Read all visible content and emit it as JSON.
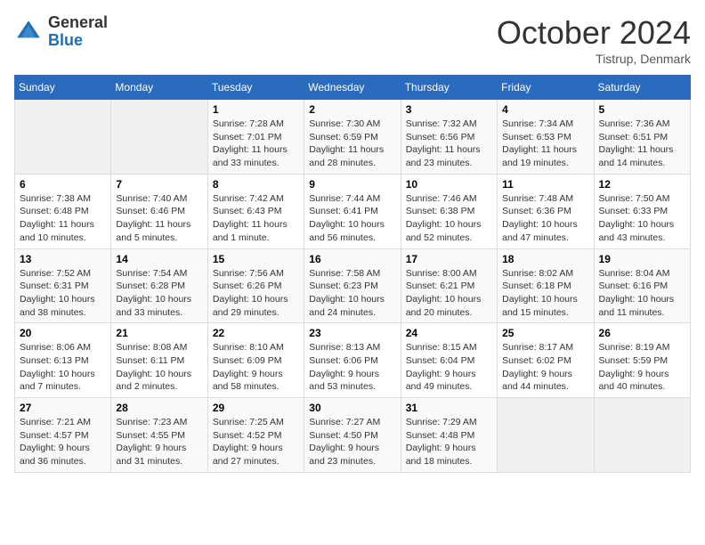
{
  "header": {
    "logo_general": "General",
    "logo_blue": "Blue",
    "month_title": "October 2024",
    "location": "Tistrup, Denmark"
  },
  "weekdays": [
    "Sunday",
    "Monday",
    "Tuesday",
    "Wednesday",
    "Thursday",
    "Friday",
    "Saturday"
  ],
  "weeks": [
    [
      {
        "day": "",
        "sunrise": "",
        "sunset": "",
        "daylight": ""
      },
      {
        "day": "",
        "sunrise": "",
        "sunset": "",
        "daylight": ""
      },
      {
        "day": "1",
        "sunrise": "Sunrise: 7:28 AM",
        "sunset": "Sunset: 7:01 PM",
        "daylight": "Daylight: 11 hours and 33 minutes."
      },
      {
        "day": "2",
        "sunrise": "Sunrise: 7:30 AM",
        "sunset": "Sunset: 6:59 PM",
        "daylight": "Daylight: 11 hours and 28 minutes."
      },
      {
        "day": "3",
        "sunrise": "Sunrise: 7:32 AM",
        "sunset": "Sunset: 6:56 PM",
        "daylight": "Daylight: 11 hours and 23 minutes."
      },
      {
        "day": "4",
        "sunrise": "Sunrise: 7:34 AM",
        "sunset": "Sunset: 6:53 PM",
        "daylight": "Daylight: 11 hours and 19 minutes."
      },
      {
        "day": "5",
        "sunrise": "Sunrise: 7:36 AM",
        "sunset": "Sunset: 6:51 PM",
        "daylight": "Daylight: 11 hours and 14 minutes."
      }
    ],
    [
      {
        "day": "6",
        "sunrise": "Sunrise: 7:38 AM",
        "sunset": "Sunset: 6:48 PM",
        "daylight": "Daylight: 11 hours and 10 minutes."
      },
      {
        "day": "7",
        "sunrise": "Sunrise: 7:40 AM",
        "sunset": "Sunset: 6:46 PM",
        "daylight": "Daylight: 11 hours and 5 minutes."
      },
      {
        "day": "8",
        "sunrise": "Sunrise: 7:42 AM",
        "sunset": "Sunset: 6:43 PM",
        "daylight": "Daylight: 11 hours and 1 minute."
      },
      {
        "day": "9",
        "sunrise": "Sunrise: 7:44 AM",
        "sunset": "Sunset: 6:41 PM",
        "daylight": "Daylight: 10 hours and 56 minutes."
      },
      {
        "day": "10",
        "sunrise": "Sunrise: 7:46 AM",
        "sunset": "Sunset: 6:38 PM",
        "daylight": "Daylight: 10 hours and 52 minutes."
      },
      {
        "day": "11",
        "sunrise": "Sunrise: 7:48 AM",
        "sunset": "Sunset: 6:36 PM",
        "daylight": "Daylight: 10 hours and 47 minutes."
      },
      {
        "day": "12",
        "sunrise": "Sunrise: 7:50 AM",
        "sunset": "Sunset: 6:33 PM",
        "daylight": "Daylight: 10 hours and 43 minutes."
      }
    ],
    [
      {
        "day": "13",
        "sunrise": "Sunrise: 7:52 AM",
        "sunset": "Sunset: 6:31 PM",
        "daylight": "Daylight: 10 hours and 38 minutes."
      },
      {
        "day": "14",
        "sunrise": "Sunrise: 7:54 AM",
        "sunset": "Sunset: 6:28 PM",
        "daylight": "Daylight: 10 hours and 33 minutes."
      },
      {
        "day": "15",
        "sunrise": "Sunrise: 7:56 AM",
        "sunset": "Sunset: 6:26 PM",
        "daylight": "Daylight: 10 hours and 29 minutes."
      },
      {
        "day": "16",
        "sunrise": "Sunrise: 7:58 AM",
        "sunset": "Sunset: 6:23 PM",
        "daylight": "Daylight: 10 hours and 24 minutes."
      },
      {
        "day": "17",
        "sunrise": "Sunrise: 8:00 AM",
        "sunset": "Sunset: 6:21 PM",
        "daylight": "Daylight: 10 hours and 20 minutes."
      },
      {
        "day": "18",
        "sunrise": "Sunrise: 8:02 AM",
        "sunset": "Sunset: 6:18 PM",
        "daylight": "Daylight: 10 hours and 15 minutes."
      },
      {
        "day": "19",
        "sunrise": "Sunrise: 8:04 AM",
        "sunset": "Sunset: 6:16 PM",
        "daylight": "Daylight: 10 hours and 11 minutes."
      }
    ],
    [
      {
        "day": "20",
        "sunrise": "Sunrise: 8:06 AM",
        "sunset": "Sunset: 6:13 PM",
        "daylight": "Daylight: 10 hours and 7 minutes."
      },
      {
        "day": "21",
        "sunrise": "Sunrise: 8:08 AM",
        "sunset": "Sunset: 6:11 PM",
        "daylight": "Daylight: 10 hours and 2 minutes."
      },
      {
        "day": "22",
        "sunrise": "Sunrise: 8:10 AM",
        "sunset": "Sunset: 6:09 PM",
        "daylight": "Daylight: 9 hours and 58 minutes."
      },
      {
        "day": "23",
        "sunrise": "Sunrise: 8:13 AM",
        "sunset": "Sunset: 6:06 PM",
        "daylight": "Daylight: 9 hours and 53 minutes."
      },
      {
        "day": "24",
        "sunrise": "Sunrise: 8:15 AM",
        "sunset": "Sunset: 6:04 PM",
        "daylight": "Daylight: 9 hours and 49 minutes."
      },
      {
        "day": "25",
        "sunrise": "Sunrise: 8:17 AM",
        "sunset": "Sunset: 6:02 PM",
        "daylight": "Daylight: 9 hours and 44 minutes."
      },
      {
        "day": "26",
        "sunrise": "Sunrise: 8:19 AM",
        "sunset": "Sunset: 5:59 PM",
        "daylight": "Daylight: 9 hours and 40 minutes."
      }
    ],
    [
      {
        "day": "27",
        "sunrise": "Sunrise: 7:21 AM",
        "sunset": "Sunset: 4:57 PM",
        "daylight": "Daylight: 9 hours and 36 minutes."
      },
      {
        "day": "28",
        "sunrise": "Sunrise: 7:23 AM",
        "sunset": "Sunset: 4:55 PM",
        "daylight": "Daylight: 9 hours and 31 minutes."
      },
      {
        "day": "29",
        "sunrise": "Sunrise: 7:25 AM",
        "sunset": "Sunset: 4:52 PM",
        "daylight": "Daylight: 9 hours and 27 minutes."
      },
      {
        "day": "30",
        "sunrise": "Sunrise: 7:27 AM",
        "sunset": "Sunset: 4:50 PM",
        "daylight": "Daylight: 9 hours and 23 minutes."
      },
      {
        "day": "31",
        "sunrise": "Sunrise: 7:29 AM",
        "sunset": "Sunset: 4:48 PM",
        "daylight": "Daylight: 9 hours and 18 minutes."
      },
      {
        "day": "",
        "sunrise": "",
        "sunset": "",
        "daylight": ""
      },
      {
        "day": "",
        "sunrise": "",
        "sunset": "",
        "daylight": ""
      }
    ]
  ]
}
